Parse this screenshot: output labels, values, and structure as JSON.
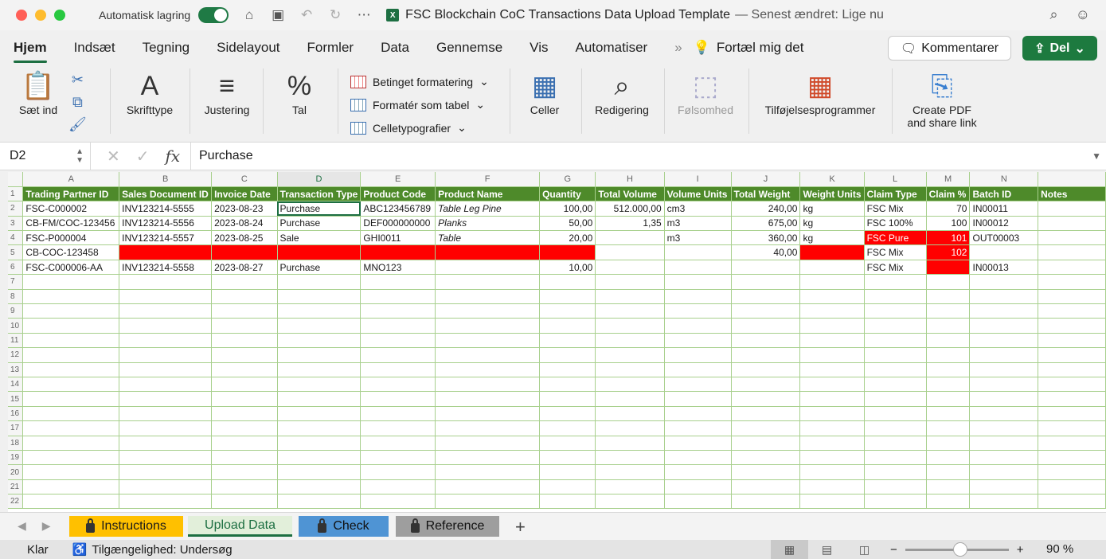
{
  "window": {
    "autosave_label": "Automatisk lagring",
    "title": "FSC Blockchain CoC Transactions Data Upload Template",
    "modified": "— Senest ændret: Lige nu"
  },
  "tabs": [
    "Hjem",
    "Indsæt",
    "Tegning",
    "Sidelayout",
    "Formler",
    "Data",
    "Gennemse",
    "Vis",
    "Automatiser"
  ],
  "tell_me": "Fortæl mig det",
  "buttons": {
    "comments": "Kommentarer",
    "share": "Del"
  },
  "ribbon": {
    "paste": "Sæt ind",
    "font": "Skrifttype",
    "alignment": "Justering",
    "number": "Tal",
    "cond_format": "Betinget formatering",
    "format_table": "Formatér som tabel",
    "cell_styles": "Celletypografier",
    "cells": "Celler",
    "editing": "Redigering",
    "sensitivity": "Følsomhed",
    "addins": "Tilføjelsesprogrammer",
    "pdf_line1": "Create PDF",
    "pdf_line2": "and share link"
  },
  "formula_bar": {
    "namebox": "D2",
    "content": "Purchase"
  },
  "columns": [
    "A",
    "B",
    "C",
    "D",
    "E",
    "F",
    "G",
    "H",
    "I",
    "J",
    "K",
    "L",
    "M",
    "N",
    ""
  ],
  "headers": [
    "Trading Partner ID",
    "Sales Document ID",
    "Invoice Date",
    "Transaction Type",
    "Product Code",
    "Product Name",
    "Quantity",
    "Total Volume",
    "Volume Units",
    "Total Weight",
    "Weight Units",
    "Claim Type",
    "Claim %",
    "Batch ID",
    "Notes"
  ],
  "rows": [
    [
      "FSC-C000002",
      "INV123214-5555",
      "2023-08-23",
      "Purchase",
      "ABC123456789",
      "Table Leg Pine",
      "100,00",
      "512.000,00",
      "cm3",
      "240,00",
      "kg",
      "FSC Mix",
      "70",
      "IN00011",
      ""
    ],
    [
      "CB-FM/COC-123456",
      "INV123214-5556",
      "2023-08-24",
      "Purchase",
      "DEF000000000",
      "Planks",
      "50,00",
      "1,35",
      "m3",
      "675,00",
      "kg",
      "FSC 100%",
      "100",
      "IN00012",
      ""
    ],
    [
      "FSC-P000004",
      "INV123214-5557",
      "2023-08-25",
      "Sale",
      "GHI0011",
      "Table",
      "20,00",
      "",
      "m3",
      "360,00",
      "kg",
      "FSC Pure",
      "101",
      "OUT00003",
      ""
    ],
    [
      "CB-COC-123458",
      "",
      "",
      "",
      "",
      "",
      "",
      "",
      "",
      "40,00",
      "",
      "FSC Mix",
      "102",
      "",
      ""
    ],
    [
      "FSC-C000006-AA",
      "INV123214-5558",
      "2023-08-27",
      "Purchase",
      "MNO123",
      "",
      "10,00",
      "",
      "",
      "",
      "",
      "FSC Mix",
      "",
      "IN00013",
      ""
    ]
  ],
  "red_cells": [
    [
      2,
      11
    ],
    [
      2,
      12
    ],
    [
      3,
      1
    ],
    [
      3,
      2
    ],
    [
      3,
      3
    ],
    [
      3,
      4
    ],
    [
      3,
      5
    ],
    [
      3,
      6
    ],
    [
      3,
      10
    ],
    [
      3,
      12
    ],
    [
      4,
      12
    ]
  ],
  "sheet_tabs": [
    "Instructions",
    "Upload Data",
    "Check",
    "Reference"
  ],
  "status": {
    "ready": "Klar",
    "accessibility": "Tilgængelighed: Undersøg",
    "zoom": "90 %"
  }
}
